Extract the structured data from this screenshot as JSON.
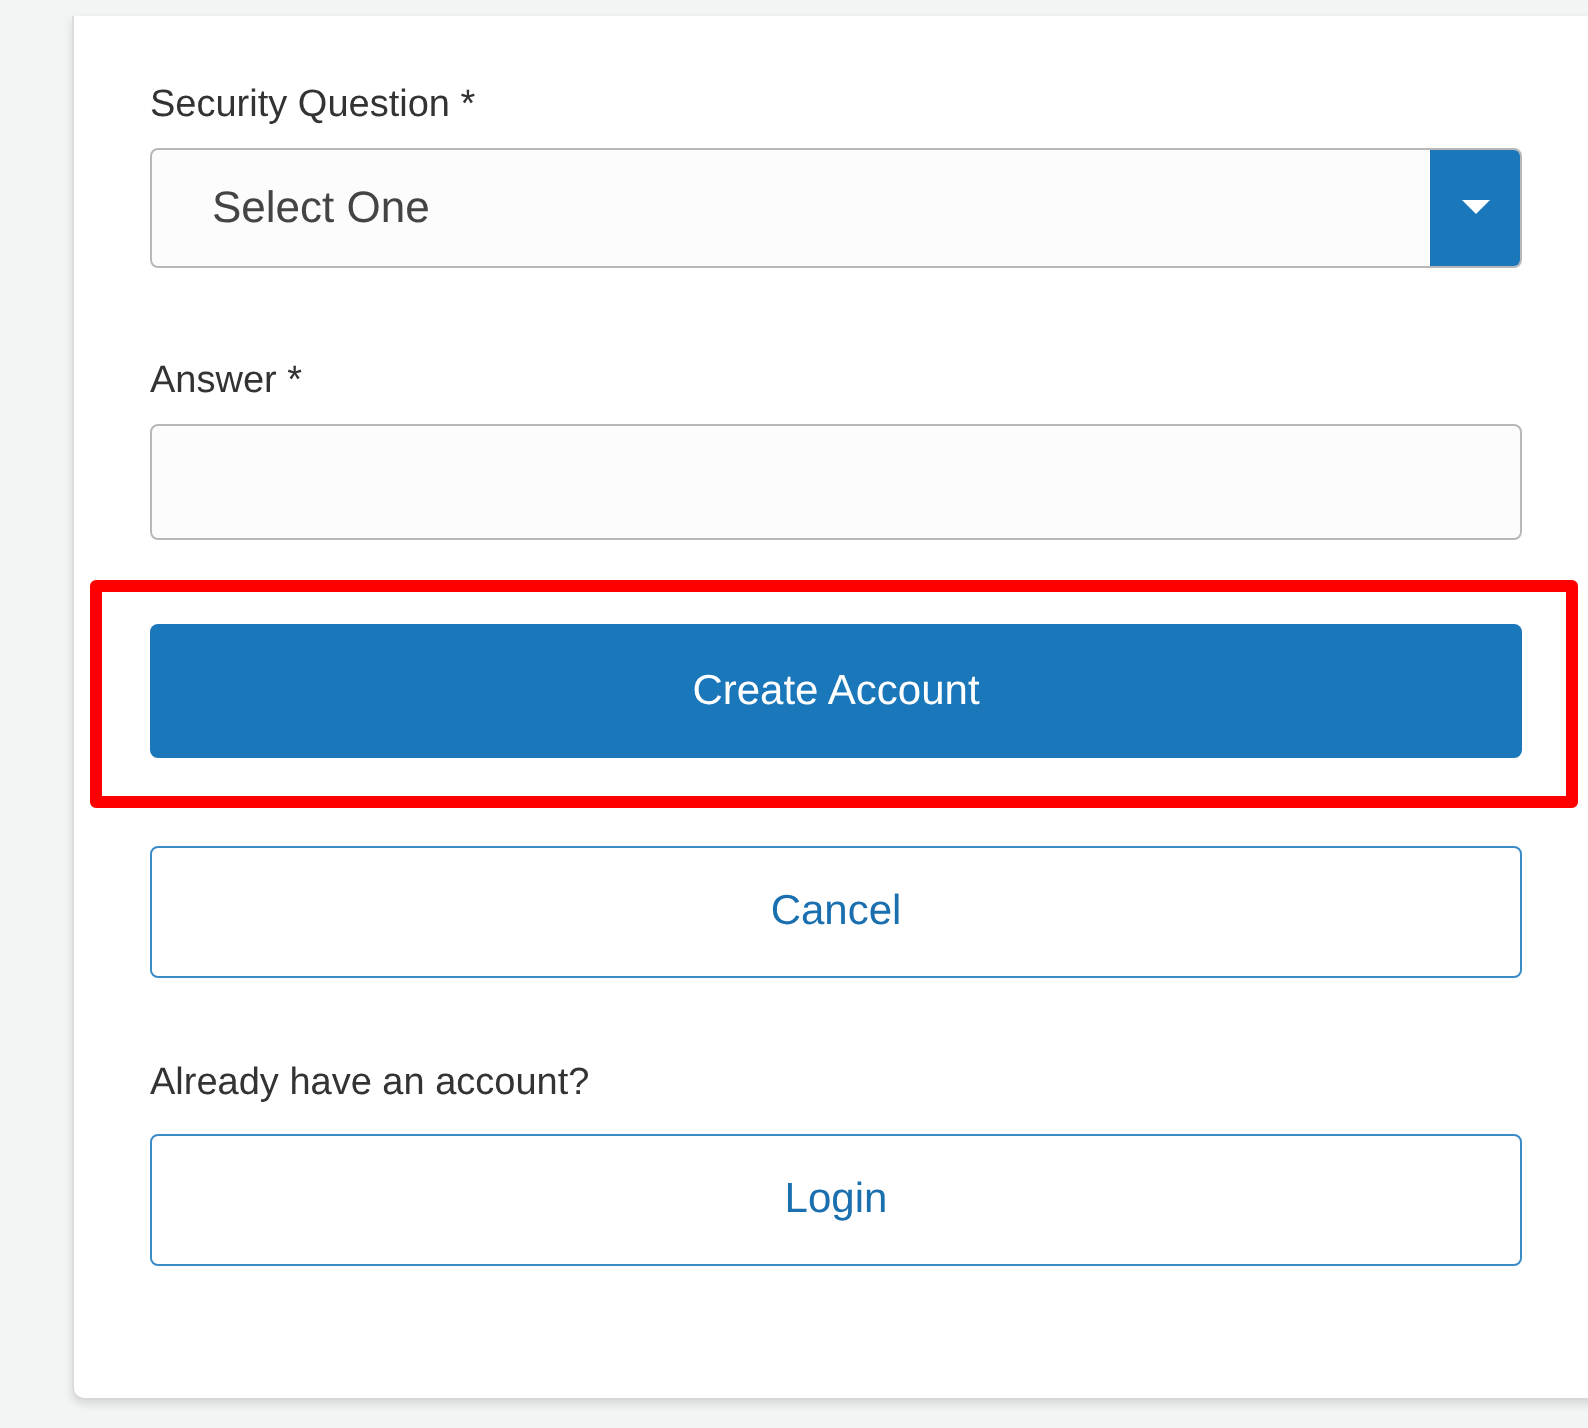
{
  "form": {
    "fields": [
      {
        "kind": "select",
        "label": "Security Question *",
        "value": "Select One"
      },
      {
        "kind": "text",
        "label": "Answer *"
      }
    ],
    "buttons": [
      {
        "kind": "primary",
        "label": "Create Account",
        "highlighted": true
      },
      {
        "kind": "outline",
        "label": "Cancel",
        "highlighted": false
      }
    ],
    "login_prompt": "Already have an account?",
    "login_button": {
      "kind": "outline",
      "label": "Login"
    }
  }
}
